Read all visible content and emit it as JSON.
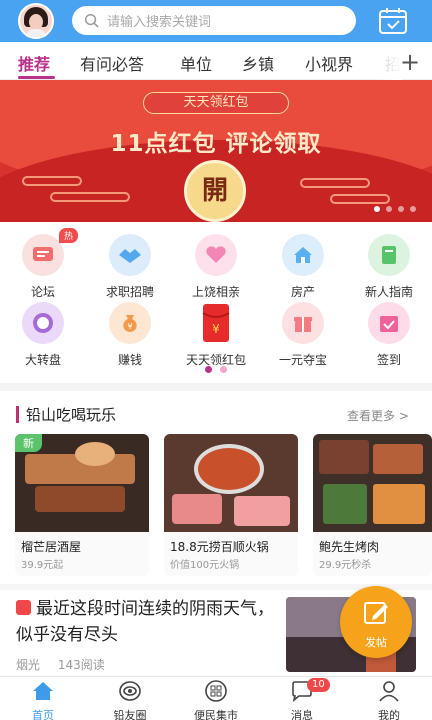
{
  "header": {
    "search_placeholder": "请输入搜索关键词"
  },
  "tabs": [
    {
      "label": "推荐",
      "active": true
    },
    {
      "label": "有问必答"
    },
    {
      "label": "单位"
    },
    {
      "label": "乡镇"
    },
    {
      "label": "小视界"
    },
    {
      "label": "招"
    }
  ],
  "banner": {
    "pill_text": "天天领红包",
    "headline": "11点红包  评论领取",
    "button_text": "開"
  },
  "grid": [
    {
      "label": "论坛",
      "icon": "forum-icon",
      "color": "#f36d6d",
      "badge": "热"
    },
    {
      "label": "求职招聘",
      "icon": "handshake-icon",
      "color": "#55a8ee"
    },
    {
      "label": "上饶相亲",
      "icon": "heart-icon",
      "color": "#f585b2"
    },
    {
      "label": "房产",
      "icon": "house-icon",
      "color": "#5ab0f0"
    },
    {
      "label": "新人指南",
      "icon": "book-icon",
      "color": "#58c46a"
    },
    {
      "label": "大转盘",
      "icon": "wheel-icon",
      "color": "#a66ad8"
    },
    {
      "label": "赚钱",
      "icon": "money-bag-icon",
      "color": "#f49a4a"
    },
    {
      "label": "天天领红包",
      "icon": "red-envelope-icon",
      "color": "#e52b2b"
    },
    {
      "label": "一元夺宝",
      "icon": "gift-icon",
      "color": "#f67a82"
    },
    {
      "label": "签到",
      "icon": "calendar-check-icon",
      "color": "#f0629a"
    }
  ],
  "section": {
    "title": "铅山吃喝玩乐",
    "more": "查看更多"
  },
  "cards": [
    {
      "name": "榴芒居酒屋",
      "sub": "39.9元起",
      "tag": "新"
    },
    {
      "name": "18.8元捞百顺火锅",
      "sub": "价值100元火锅"
    },
    {
      "name": "鲍先生烤肉",
      "sub": "29.9元秒杀"
    }
  ],
  "article": {
    "title": "最近这段时间连续的阴雨天气，似乎没有尽头",
    "author": "烟光",
    "reads": "143阅读"
  },
  "fab": {
    "label": "发帖"
  },
  "bottom_nav": [
    {
      "label": "首页",
      "active": true
    },
    {
      "label": "铅友圈"
    },
    {
      "label": "便民集市"
    },
    {
      "label": "消息",
      "badge": "10"
    },
    {
      "label": "我的"
    }
  ],
  "colors": {
    "header_blue": "#4aa3f0",
    "accent_purple": "#b8318a",
    "banner_red": "#d8322f",
    "fab_orange": "#f6a21a"
  }
}
